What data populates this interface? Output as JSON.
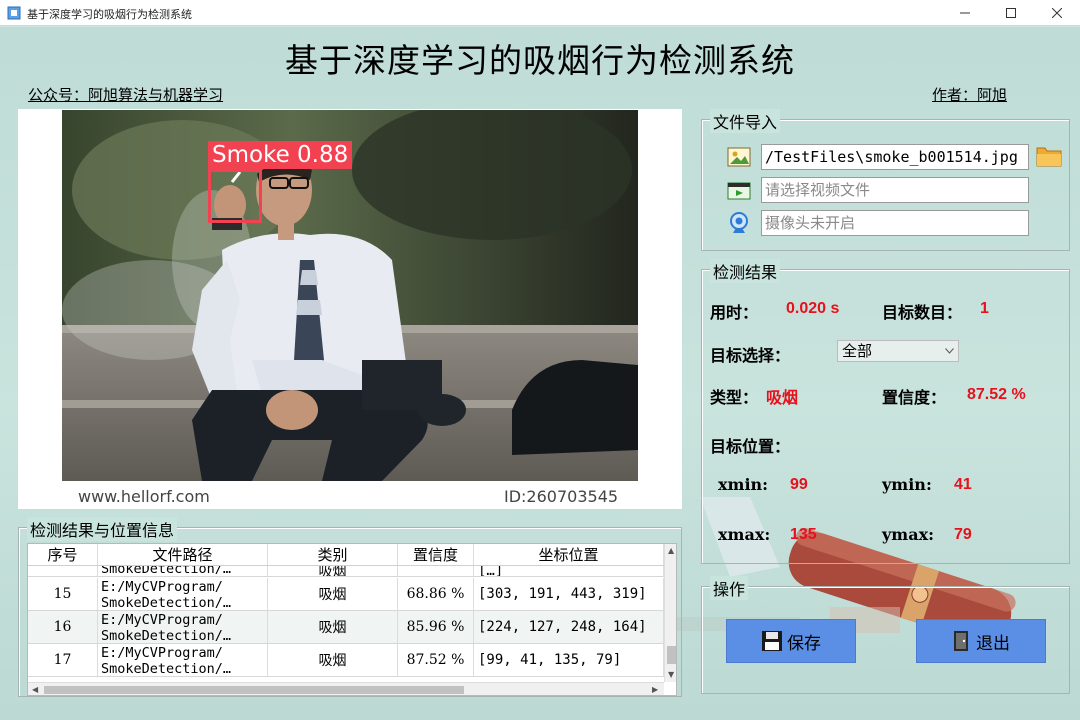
{
  "window": {
    "title": "基于深度学习的吸烟行为检测系统"
  },
  "header": {
    "app_title": "基于深度学习的吸烟行为检测系统",
    "account": "公众号：阿旭算法与机器学习",
    "author": "作者：阿旭"
  },
  "image": {
    "detection_label": "Smoke 0.88",
    "watermark_left": "www.hellorf.com",
    "watermark_right": "ID:260703545"
  },
  "file_import": {
    "title": "文件导入",
    "image_path": "/TestFiles\\smoke_b001514.jpg",
    "video_placeholder": "请选择视频文件",
    "camera_placeholder": "摄像头未开启"
  },
  "detection": {
    "title": "检测结果",
    "time_label": "用时：",
    "time_value": "0.020 s",
    "count_label": "目标数目：",
    "count_value": "1",
    "select_label": "目标选择：",
    "select_value": "全部",
    "type_label": "类型：",
    "type_value": "吸烟",
    "conf_label": "置信度：",
    "conf_value": "87.52 %",
    "pos_label": "目标位置：",
    "xmin_label": "xmin:",
    "xmin_value": "99",
    "ymin_label": "ymin:",
    "ymin_value": "41",
    "xmax_label": "xmax:",
    "xmax_value": "135",
    "ymax_label": "ymax:",
    "ymax_value": "79"
  },
  "operations": {
    "title": "操作",
    "save": "保存",
    "exit": "退出"
  },
  "table": {
    "title": "检测结果与位置信息",
    "headers": [
      "序号",
      "文件路径",
      "类别",
      "置信度",
      "坐标位置"
    ],
    "partial_row": {
      "index": "",
      "path": "SmokeDetection/…",
      "cls": "吸烟",
      "conf": "",
      "coord": "[…]"
    },
    "rows": [
      {
        "index": "15",
        "path1": "E:/MyCVProgram/",
        "path2": "SmokeDetection/…",
        "cls": "吸烟",
        "conf": "68.86 %",
        "coord": "[303, 191, 443, 319]"
      },
      {
        "index": "16",
        "path1": "E:/MyCVProgram/",
        "path2": "SmokeDetection/…",
        "cls": "吸烟",
        "conf": "85.96 %",
        "coord": "[224, 127, 248, 164]"
      },
      {
        "index": "17",
        "path1": "E:/MyCVProgram/",
        "path2": "SmokeDetection/…",
        "cls": "吸烟",
        "conf": "87.52 %",
        "coord": "[99, 41, 135, 79]"
      }
    ]
  },
  "icons": {
    "app": "app-icon",
    "minimize": "minimize-icon",
    "maximize": "maximize-icon",
    "close": "close-icon",
    "image_file": "image-file-icon",
    "video_file": "video-file-icon",
    "camera": "camera-icon",
    "folder": "folder-icon",
    "save": "save-disk-icon",
    "exit": "exit-door-icon"
  },
  "colors": {
    "background": "#c9e3dd",
    "accent_red": "#e8101c",
    "detection_box": "#f24150",
    "button": "#5b8fe6"
  }
}
